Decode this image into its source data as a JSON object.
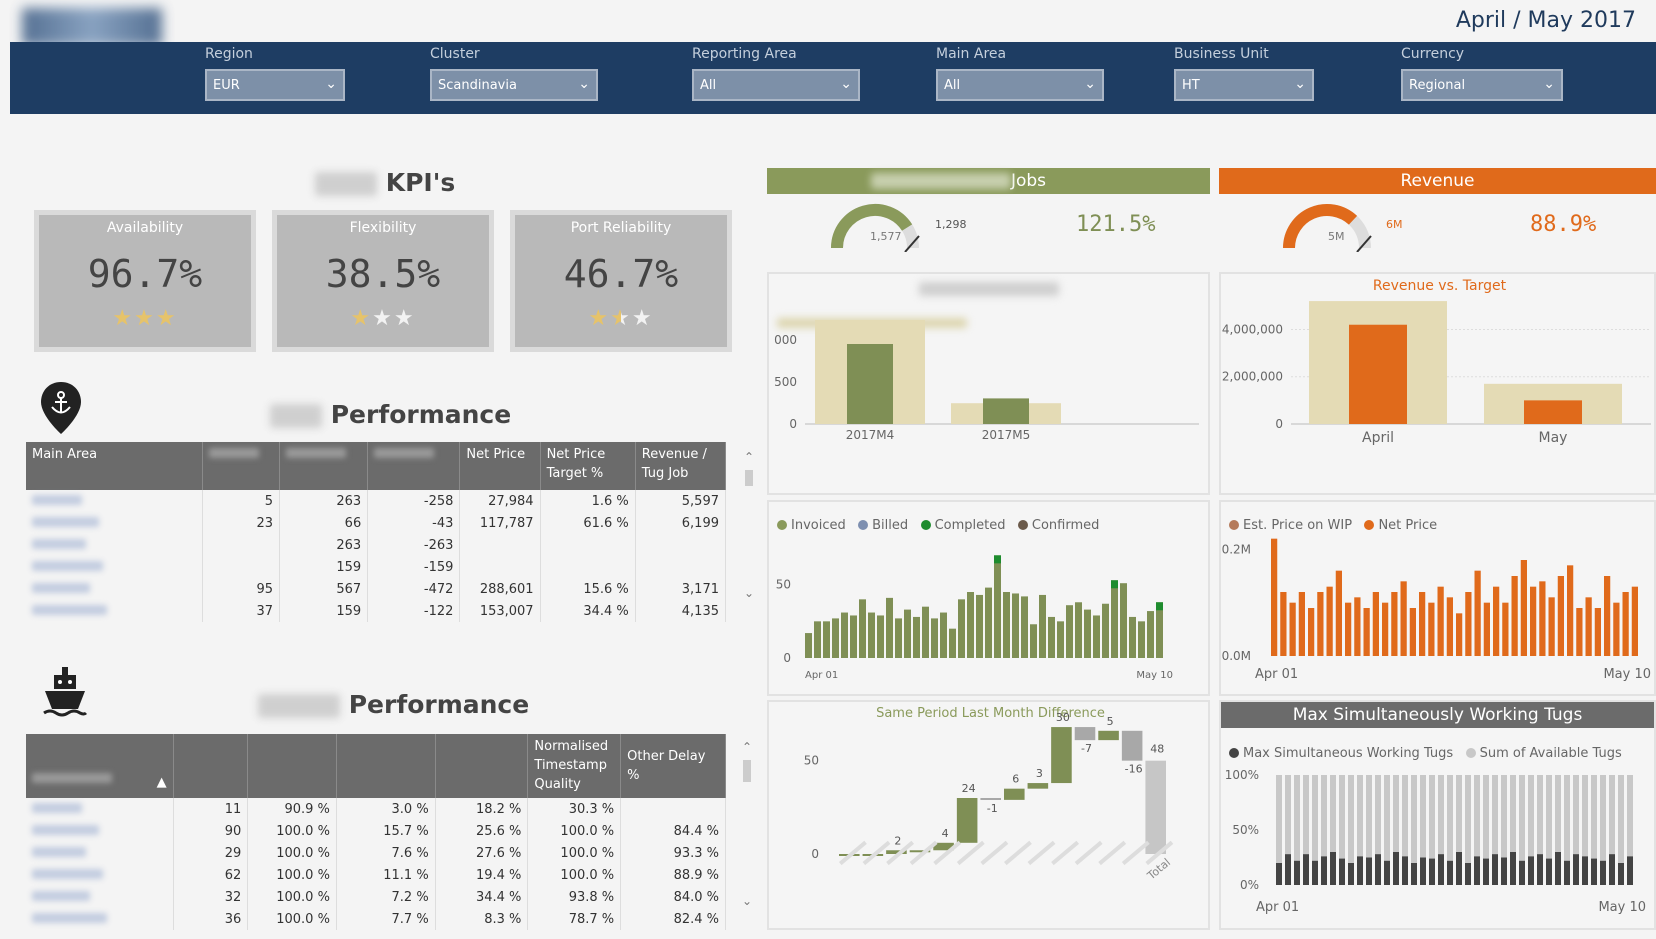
{
  "period": "April / May 2017",
  "filters": [
    {
      "label": "Region",
      "value": "EUR"
    },
    {
      "label": "Cluster",
      "value": "Scandinavia"
    },
    {
      "label": "Reporting Area",
      "value": "All"
    },
    {
      "label": "Main Area",
      "value": "All"
    },
    {
      "label": "Business Unit",
      "value": "HT"
    },
    {
      "label": "Currency",
      "value": "Regional"
    }
  ],
  "kpi_section": {
    "title": "KPI's"
  },
  "kpis": [
    {
      "label": "Availability",
      "value": "96.7%",
      "stars": 3
    },
    {
      "label": "Flexibility",
      "value": "38.5%",
      "stars": 1
    },
    {
      "label": "Port Reliability",
      "value": "46.7%",
      "stars": 1.5
    }
  ],
  "port_section": {
    "title": "Performance"
  },
  "port_table": {
    "headers": [
      "Main Area",
      "",
      "",
      "",
      "Net Price",
      "Net Price Target %",
      "Revenue / Tug Job"
    ],
    "rows": [
      [
        "",
        "5",
        "263",
        "-258",
        "27,984",
        "1.6 %",
        "5,597"
      ],
      [
        "",
        "23",
        "66",
        "-43",
        "117,787",
        "61.6 %",
        "6,199"
      ],
      [
        "",
        "",
        "263",
        "-263",
        "",
        "",
        ""
      ],
      [
        "",
        "",
        "159",
        "-159",
        "",
        "",
        ""
      ],
      [
        "",
        "95",
        "567",
        "-472",
        "288,601",
        "15.6 %",
        "3,171"
      ],
      [
        "",
        "37",
        "159",
        "-122",
        "153,007",
        "34.4 %",
        "4,135"
      ]
    ]
  },
  "vessel_section": {
    "title": "Performance"
  },
  "vessel_table": {
    "headers": [
      "",
      "",
      "",
      "",
      "",
      "Normalised Timestamp Quality",
      "Other Delay %"
    ],
    "rows": [
      [
        "",
        "11",
        "90.9 %",
        "3.0 %",
        "18.2 %",
        "30.3 %",
        ""
      ],
      [
        "",
        "90",
        "100.0 %",
        "15.7 %",
        "25.6 %",
        "100.0 %",
        "84.4 %"
      ],
      [
        "",
        "29",
        "100.0 %",
        "7.6 %",
        "27.6 %",
        "100.0 %",
        "93.3 %"
      ],
      [
        "",
        "62",
        "100.0 %",
        "11.1 %",
        "19.4 %",
        "100.0 %",
        "88.9 %"
      ],
      [
        "",
        "32",
        "100.0 %",
        "7.2 %",
        "34.4 %",
        "93.8 %",
        "84.0 %"
      ],
      [
        "",
        "36",
        "100.0 %",
        "7.7 %",
        "8.3 %",
        "78.7 %",
        "82.4 %"
      ]
    ]
  },
  "jobs": {
    "title": "Jobs",
    "gauge_value": "1,577",
    "gauge_target": "1,298",
    "gauge_fraction": 0.82,
    "pct": "121.5%",
    "color": "#8a9a5b"
  },
  "revenue": {
    "title": "Revenue",
    "gauge_value": "5M",
    "gauge_target": "6M",
    "gauge_fraction": 0.74,
    "pct": "88.9%",
    "color": "#e06a1b"
  },
  "colors": {
    "olive": "#7f8f55",
    "beige": "#e4dbb5",
    "orange": "#e06a1b",
    "navy": "#1e3d63",
    "grey": "#6b6b6b"
  },
  "chart_data": [
    {
      "type": "bar",
      "categories": [
        "2017M4",
        "2017M5"
      ],
      "series": [
        {
          "values": [
            1300,
            260
          ]
        },
        {
          "values": [
            1000,
            320
          ]
        }
      ],
      "ytick_labels": [
        "0",
        "500",
        "000"
      ]
    },
    {
      "type": "bar",
      "title": "Revenue vs. Target",
      "categories": [
        "April",
        "May"
      ],
      "series": [
        {
          "values": [
            5200000,
            1700000
          ]
        },
        {
          "values": [
            4200000,
            1000000
          ]
        }
      ],
      "ylim": [
        0,
        5500000
      ],
      "ytick_labels": [
        "0",
        "2,000,000",
        "4,000,000"
      ]
    },
    {
      "type": "bar",
      "legend": [
        "Invoiced",
        "Billed",
        "Completed",
        "Confirmed"
      ],
      "x_start": "Apr 01",
      "x_end": "May 10",
      "ytick_labels": [
        "0",
        "50"
      ],
      "values": [
        17,
        25,
        25,
        27,
        31,
        29,
        40,
        31,
        29,
        41,
        27,
        33,
        28,
        35,
        27,
        31,
        20,
        40,
        45,
        43,
        48,
        70,
        45,
        44,
        42,
        23,
        43,
        28,
        25,
        36,
        38,
        33,
        29,
        37,
        53,
        51,
        28,
        25,
        32,
        38
      ]
    },
    {
      "type": "bar",
      "legend": [
        "Est. Price on WIP",
        "Net Price"
      ],
      "x_start": "Apr 01",
      "x_end": "May 10",
      "ytick_labels": [
        "0.0M",
        "0.2M"
      ],
      "values": [
        0.22,
        0.12,
        0.1,
        0.12,
        0.09,
        0.12,
        0.13,
        0.16,
        0.1,
        0.11,
        0.09,
        0.12,
        0.1,
        0.12,
        0.14,
        0.09,
        0.12,
        0.1,
        0.13,
        0.11,
        0.08,
        0.12,
        0.16,
        0.1,
        0.13,
        0.1,
        0.15,
        0.18,
        0.13,
        0.14,
        0.11,
        0.15,
        0.17,
        0.09,
        0.11,
        0.09,
        0.15,
        0.1,
        0.12,
        0.13
      ]
    },
    {
      "type": "bar",
      "title": "Same Period Last Month Difference",
      "subtype": "waterfall",
      "ytick_labels": [
        "0",
        "50"
      ],
      "steps": [
        0,
        0,
        2,
        0,
        4,
        24,
        -1,
        6,
        3,
        30,
        -7,
        5,
        -16,
        48
      ],
      "labels": [
        "2",
        "4",
        "24",
        "-1",
        "6",
        "3",
        "30",
        "-7",
        "5",
        "-16",
        "48"
      ],
      "last_label": "Total"
    },
    {
      "type": "bar",
      "title": "Max Simultaneously Working Tugs",
      "legend": [
        "Max Simultaneous Working Tugs",
        "Sum of Available Tugs"
      ],
      "x_start": "Apr 01",
      "x_end": "May 10",
      "ytick_labels": [
        "0%",
        "50%",
        "100%"
      ],
      "values": [
        0.2,
        0.28,
        0.22,
        0.28,
        0.22,
        0.26,
        0.3,
        0.24,
        0.2,
        0.26,
        0.25,
        0.28,
        0.22,
        0.3,
        0.26,
        0.2,
        0.25,
        0.24,
        0.28,
        0.22,
        0.3,
        0.2,
        0.26,
        0.24,
        0.28,
        0.25,
        0.3,
        0.22,
        0.26,
        0.28,
        0.24,
        0.3,
        0.22,
        0.28,
        0.26,
        0.24,
        0.22,
        0.28,
        0.2,
        0.26
      ]
    }
  ]
}
